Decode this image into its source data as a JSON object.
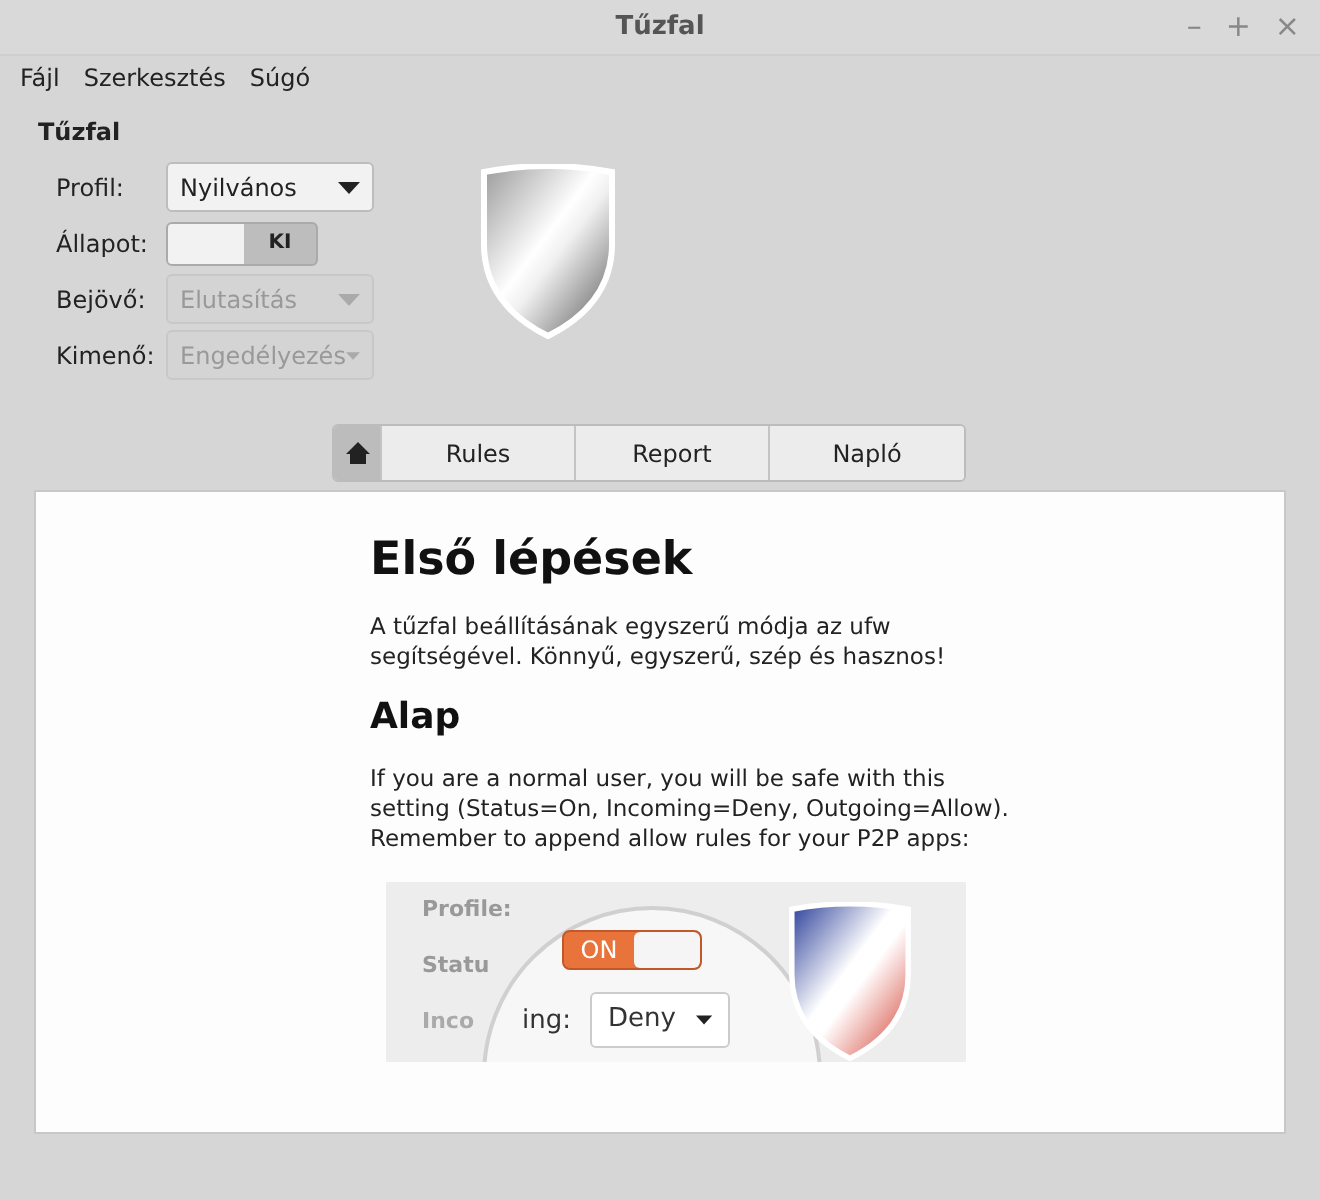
{
  "window": {
    "title": "Tűzfal",
    "controls": [
      "–",
      "+",
      "×"
    ]
  },
  "menu": [
    "Fájl",
    "Szerkesztés",
    "Súgó"
  ],
  "firewall": {
    "heading": "Tűzfal",
    "fields": [
      {
        "kind": "dropdown",
        "label": "Profil:",
        "value": "Nyilvános",
        "disabled": false
      },
      {
        "kind": "switch",
        "label": "Állapot:",
        "value": "KI",
        "on": false
      },
      {
        "kind": "dropdown",
        "label": "Bejövő:",
        "value": "Elutasítás",
        "disabled": true
      },
      {
        "kind": "dropdown",
        "label": "Kimenő:",
        "value": "Engedélyezés",
        "disabled": true
      }
    ]
  },
  "tabs": [
    {
      "kind": "home",
      "selected": true
    },
    {
      "kind": "text",
      "label": "Rules",
      "selected": false
    },
    {
      "kind": "text",
      "label": "Report",
      "selected": false
    },
    {
      "kind": "text",
      "label": "Napló",
      "selected": false
    }
  ],
  "content": {
    "title": "Első lépések",
    "intro": "A tűzfal beállításának egyszerű módja az ufw segítségével. Könnyű, egyszerű, szép és hasznos!",
    "section": "Alap",
    "body": "If you are a normal user, you will be safe with this setting (Status=On, Incoming=Deny, Outgoing=Allow). Remember to append allow rules for your P2P apps:",
    "screenshot": {
      "profile_label": "Profile:",
      "status_label": "Statu",
      "switch_label": "ON",
      "switch_on": true,
      "incoming_label_1": "Inco",
      "incoming_label_2": "ing:",
      "incoming_value": "Deny"
    }
  }
}
